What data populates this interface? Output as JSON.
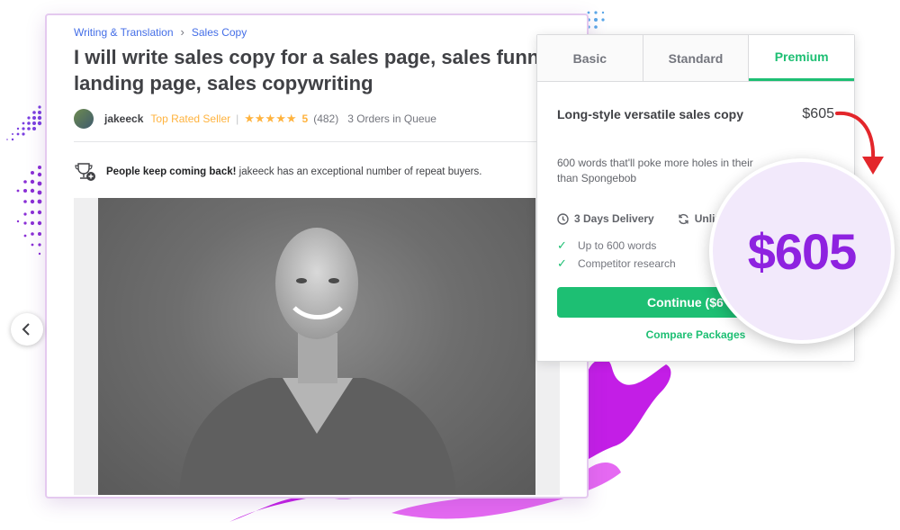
{
  "breadcrumb": {
    "category": "Writing & Translation",
    "subcategory": "Sales Copy"
  },
  "gig": {
    "title": "I will write sales copy for a sales page, sales funnel, landing page, sales copywriting"
  },
  "seller": {
    "name": "jakeeck",
    "level": "Top Rated Seller",
    "rating": "5",
    "stars": "★★★★★",
    "reviews": "(482)",
    "queue": "3 Orders in Queue"
  },
  "repeat_buyers": {
    "bold": "People keep coming back!",
    "text": "jakeeck has an exceptional number of repeat buyers."
  },
  "pricing": {
    "tabs": [
      {
        "label": "Basic"
      },
      {
        "label": "Standard"
      },
      {
        "label": "Premium"
      }
    ],
    "package_title": "Long-style versatile sales copy",
    "price": "$605",
    "description": "600 words that'll poke more holes in their than Spongebob",
    "delivery": "3 Days Delivery",
    "revisions": "Unlim",
    "features": [
      {
        "label": "Up to 600 words"
      },
      {
        "label": "Competitor research"
      }
    ],
    "continue_label": "Continue ($6",
    "compare_label": "Compare Packages"
  },
  "magnifier": {
    "price": "$605"
  },
  "colors": {
    "fiverr_green": "#1dbf73",
    "link_blue": "#446ee7",
    "star_gold": "#ffb33e",
    "accent_purple": "#8e22e0"
  }
}
